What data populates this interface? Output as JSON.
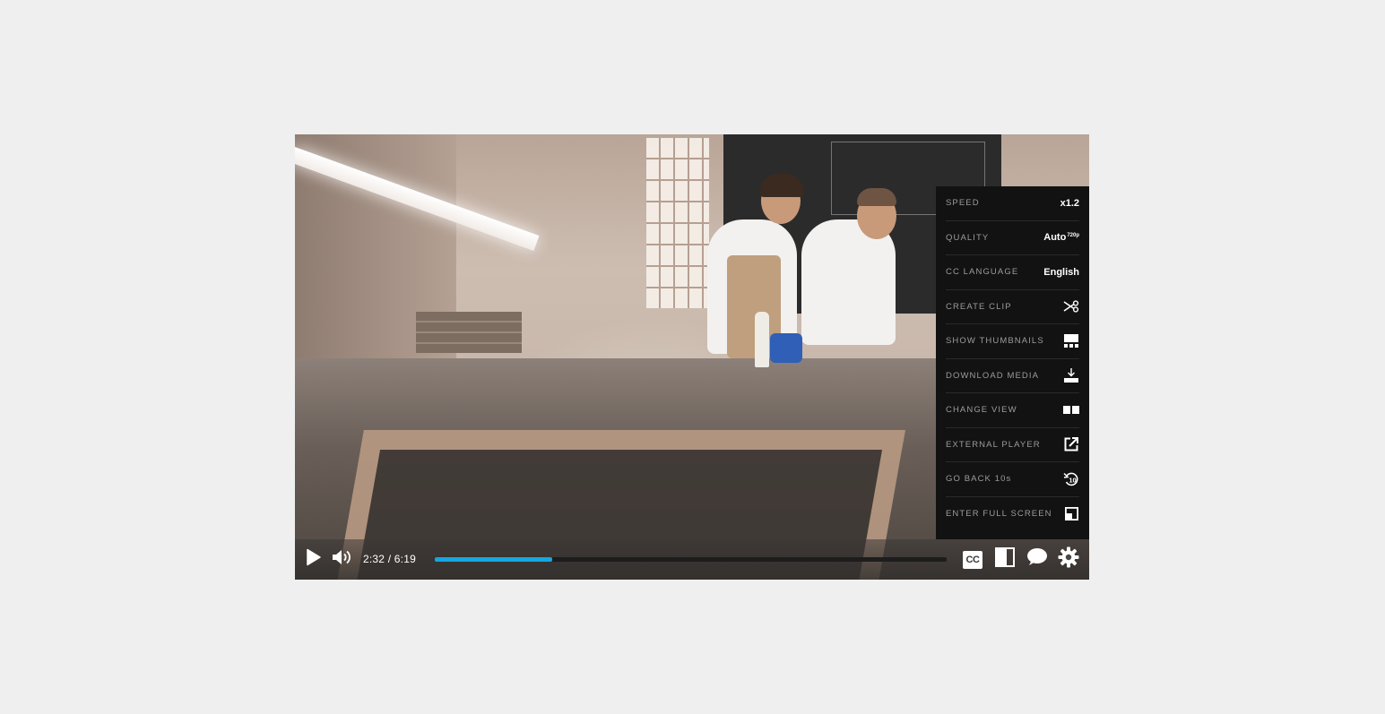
{
  "player": {
    "current_time": "2:32",
    "time_separator": "/",
    "duration": "6:19",
    "progress_fraction": 0.23,
    "accent_color": "#16a7e0"
  },
  "settings_menu": {
    "items": [
      {
        "label": "SPEED",
        "value": "x1.2"
      },
      {
        "label": "QUALITY",
        "value": "Auto",
        "value_sup": "720p"
      },
      {
        "label": "CC LANGUAGE",
        "value": "English"
      },
      {
        "label": "CREATE CLIP",
        "icon": "scissors-icon"
      },
      {
        "label": "SHOW THUMBNAILS",
        "icon": "thumbnails-icon"
      },
      {
        "label": "DOWNLOAD MEDIA",
        "icon": "download-icon"
      },
      {
        "label": "CHANGE VIEW",
        "icon": "change-view-icon"
      },
      {
        "label": "EXTERNAL PLAYER",
        "icon": "external-link-icon"
      },
      {
        "label": "GO BACK 10s",
        "icon": "rewind-10-icon"
      },
      {
        "label": "ENTER FULL SCREEN",
        "icon": "fullscreen-icon"
      }
    ]
  },
  "controls": {
    "cc_label": "CC",
    "icons": [
      "play-icon",
      "volume-icon",
      "cc-icon",
      "layout-icon",
      "chat-icon",
      "gear-icon"
    ]
  }
}
